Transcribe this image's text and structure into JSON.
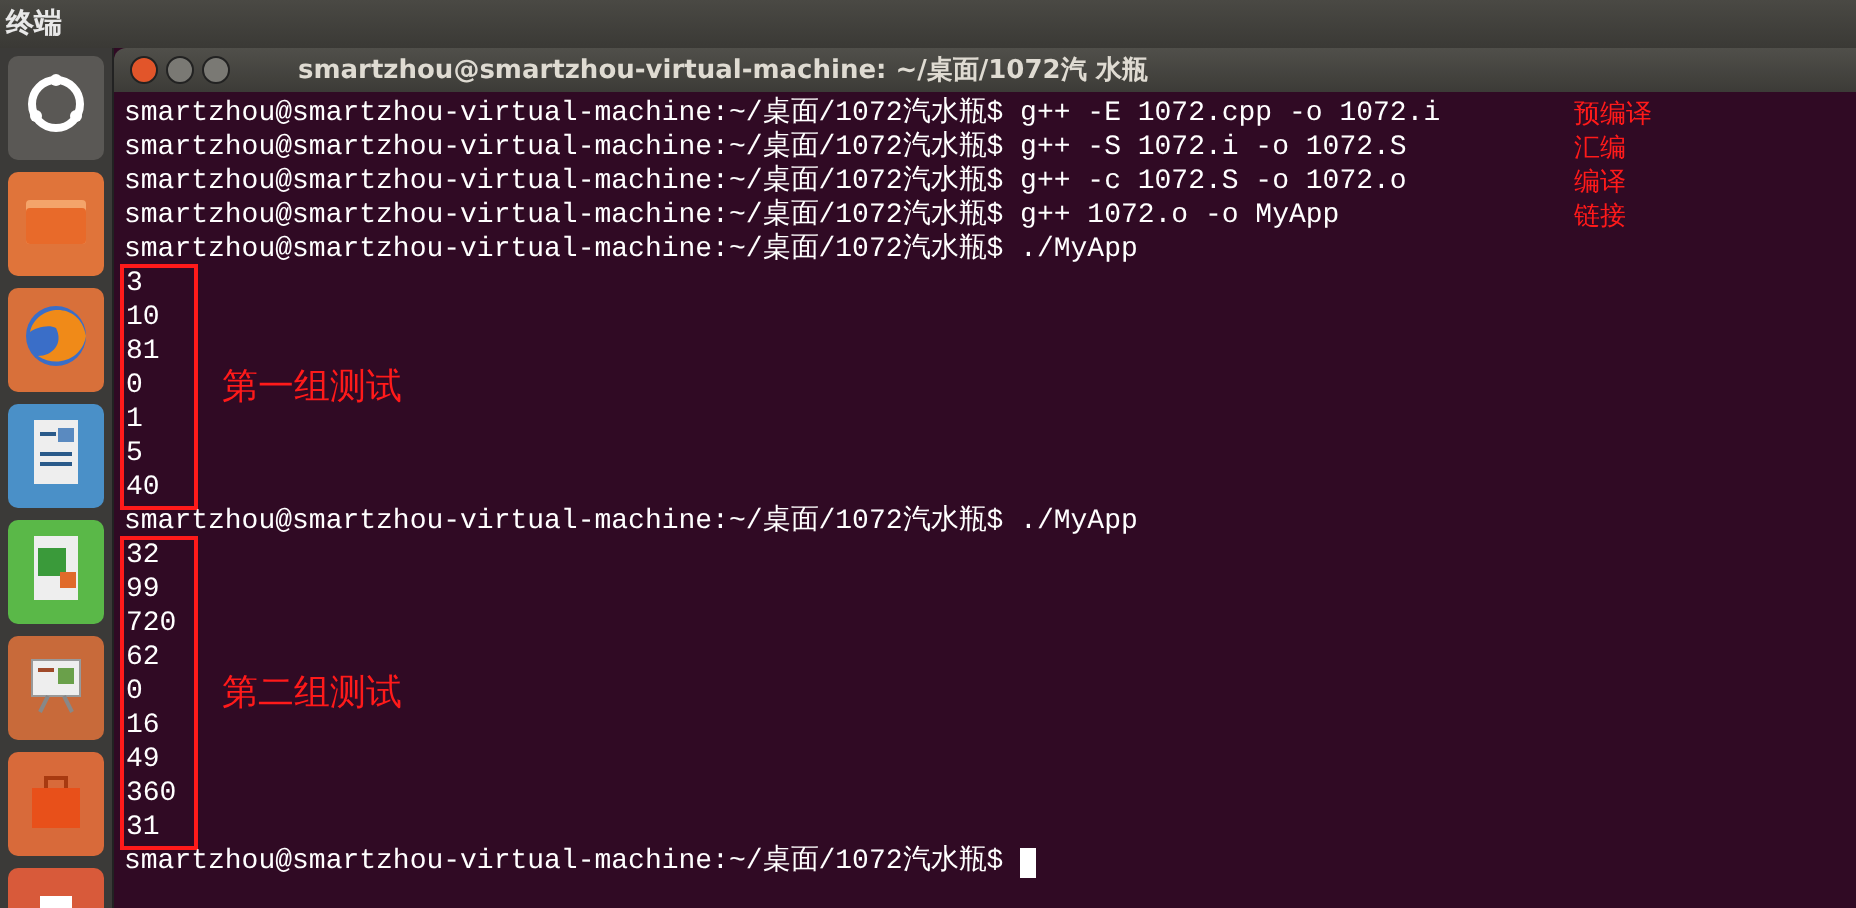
{
  "top_bar": {
    "title": "终端"
  },
  "window": {
    "title": "smartzhou@smartzhou-virtual-machine: ~/桌面/1072汽 水瓶"
  },
  "terminal": {
    "blocks": [
      {
        "kind": "command",
        "text": "smartzhou@smartzhou-virtual-machine:~/桌面/1072汽水瓶$ g++ -E 1072.cpp -o 1072.i",
        "note": "预编译"
      },
      {
        "kind": "command",
        "text": "smartzhou@smartzhou-virtual-machine:~/桌面/1072汽水瓶$ g++ -S 1072.i -o 1072.S",
        "note": "汇编"
      },
      {
        "kind": "command",
        "text": "smartzhou@smartzhou-virtual-machine:~/桌面/1072汽水瓶$ g++ -c 1072.S -o 1072.o",
        "note": "编译"
      },
      {
        "kind": "command",
        "text": "smartzhou@smartzhou-virtual-machine:~/桌面/1072汽水瓶$ g++ 1072.o -o MyApp",
        "note": "链接"
      },
      {
        "kind": "command",
        "text": "smartzhou@smartzhou-virtual-machine:~/桌面/1072汽水瓶$ ./MyApp"
      },
      {
        "kind": "output",
        "label": "第一组测试",
        "values": [
          "3",
          "10",
          "81",
          "0",
          "1",
          "5",
          "40"
        ]
      },
      {
        "kind": "command",
        "text": "smartzhou@smartzhou-virtual-machine:~/桌面/1072汽水瓶$ ./MyApp"
      },
      {
        "kind": "output",
        "label": "第二组测试",
        "values": [
          "32",
          "99",
          "720",
          "62",
          "0",
          "16",
          "49",
          "360",
          "31"
        ]
      },
      {
        "kind": "command",
        "text": "smartzhou@smartzhou-virtual-machine:~/桌面/1072汽水瓶$",
        "cursor": true
      }
    ]
  }
}
